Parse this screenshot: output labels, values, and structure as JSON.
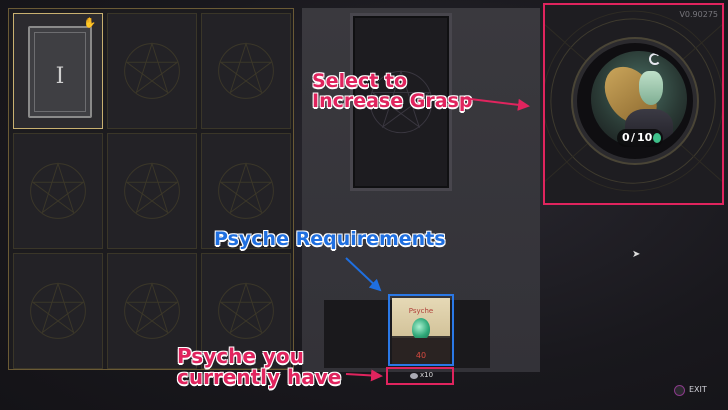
{
  "version": "V0.90275",
  "arcana_grid": {
    "selected_numeral": "I",
    "slots": 9
  },
  "grasp": {
    "current": "0",
    "separator": "/",
    "max": "10"
  },
  "psyche_card": {
    "label": "Psyche",
    "value": "40"
  },
  "psyche_have": {
    "text": "x10"
  },
  "annotations": {
    "grasp_line1": "Select to",
    "grasp_line2": "Increase Grasp",
    "requirements": "Psyche Requirements",
    "have_line1": "Psyche you",
    "have_line2": "currently have"
  },
  "exit_label": "EXIT",
  "colors": {
    "annotation_pink": "#e0245e",
    "annotation_blue": "#1f6fe0",
    "gold_frame": "#c8b070",
    "psyche_green": "#3ec08a"
  },
  "icons": [
    "hand-icon",
    "psyche-gem-icon",
    "exit-button-icon",
    "cursor-icon"
  ]
}
